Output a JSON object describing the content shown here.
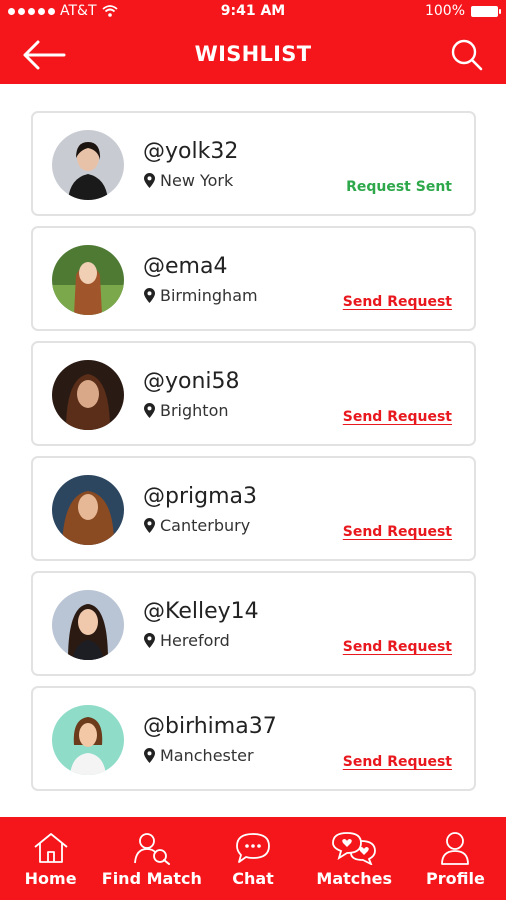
{
  "status_bar": {
    "carrier": "AT&T",
    "time": "9:41 AM",
    "battery": "100%"
  },
  "header": {
    "title": "WISHLIST",
    "back_icon": "arrow-left-icon",
    "search_icon": "search-icon"
  },
  "colors": {
    "brand": "#f5161c",
    "sent": "#2ea84a",
    "send": "#e8181e"
  },
  "wishlist": [
    {
      "username": "@yolk32",
      "location": "New York",
      "action": "Request Sent",
      "status": "sent"
    },
    {
      "username": "@ema4",
      "location": "Birmingham",
      "action": "Send Request",
      "status": "send"
    },
    {
      "username": "@yoni58",
      "location": "Brighton",
      "action": "Send Request",
      "status": "send"
    },
    {
      "username": "@prigma3",
      "location": "Canterbury",
      "action": "Send Request",
      "status": "send"
    },
    {
      "username": "@Kelley14",
      "location": "Hereford",
      "action": "Send Request",
      "status": "send"
    },
    {
      "username": "@birhima37",
      "location": "Manchester",
      "action": "Send Request",
      "status": "send"
    }
  ],
  "tabs": [
    {
      "label": "Home",
      "icon": "home-icon"
    },
    {
      "label": "Find Match",
      "icon": "find-match-icon"
    },
    {
      "label": "Chat",
      "icon": "chat-icon"
    },
    {
      "label": "Matches",
      "icon": "matches-icon"
    },
    {
      "label": "Profile",
      "icon": "profile-icon"
    }
  ]
}
